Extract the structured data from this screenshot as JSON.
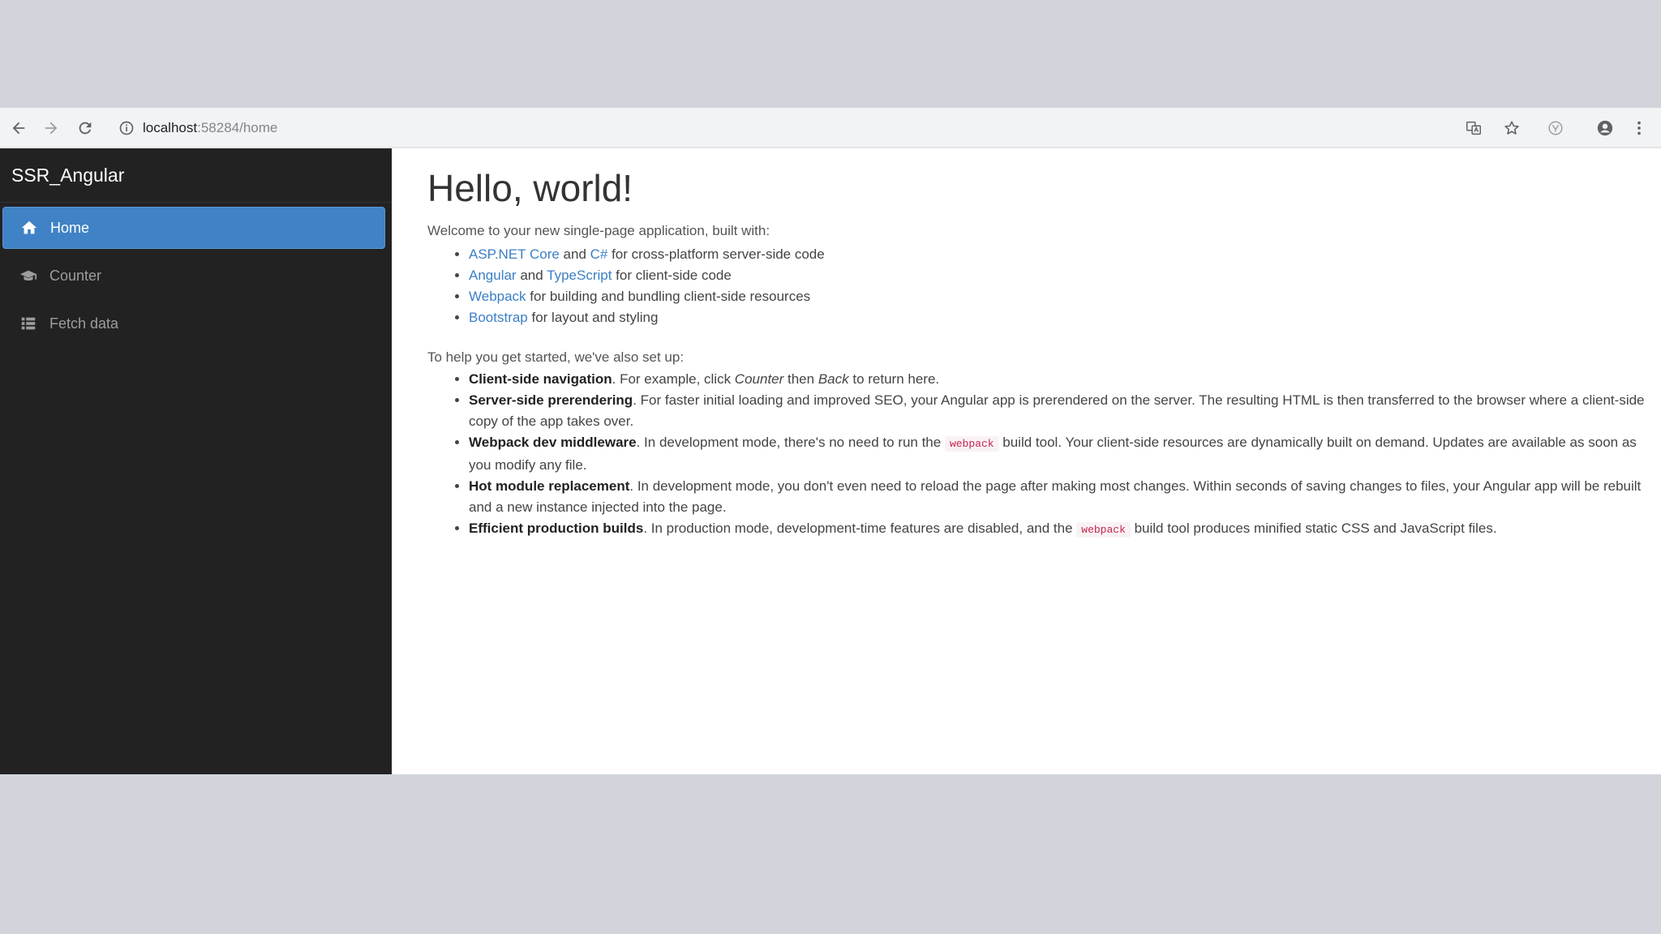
{
  "browser": {
    "url_host": "localhost",
    "url_rest": ":58284/home"
  },
  "sidebar": {
    "brand": "SSR_Angular",
    "items": [
      {
        "label": "Home",
        "icon": "home-icon"
      },
      {
        "label": "Counter",
        "icon": "graduation-cap-icon"
      },
      {
        "label": "Fetch data",
        "icon": "list-icon"
      }
    ]
  },
  "main": {
    "title": "Hello, world!",
    "intro": "Welcome to your new single-page application, built with:",
    "built_with": [
      {
        "link1": "ASP.NET Core",
        "mid": " and ",
        "link2": "C#",
        "rest": " for cross-platform server-side code"
      },
      {
        "link1": "Angular",
        "mid": " and ",
        "link2": "TypeScript",
        "rest": " for client-side code"
      },
      {
        "link1": "Webpack",
        "rest": " for building and bundling client-side resources"
      },
      {
        "link1": "Bootstrap",
        "rest": " for layout and styling"
      }
    ],
    "setup_intro": "To help you get started, we've also set up:",
    "features": [
      {
        "bold": "Client-side navigation",
        "t1": ". For example, click ",
        "em1": "Counter",
        "t2": " then ",
        "em2": "Back",
        "t3": " to return here."
      },
      {
        "bold": "Server-side prerendering",
        "text": ". For faster initial loading and improved SEO, your Angular app is prerendered on the server. The resulting HTML is then transferred to the browser where a client-side copy of the app takes over."
      },
      {
        "bold": "Webpack dev middleware",
        "t1": ". In development mode, there's no need to run the ",
        "code": "webpack",
        "t2": " build tool. Your client-side resources are dynamically built on demand. Updates are available as soon as you modify any file."
      },
      {
        "bold": "Hot module replacement",
        "text": ". In development mode, you don't even need to reload the page after making most changes. Within seconds of saving changes to files, your Angular app will be rebuilt and a new instance injected into the page."
      },
      {
        "bold": "Efficient production builds",
        "t1": ". In production mode, development-time features are disabled, and the ",
        "code": "webpack",
        "t2": " build tool produces minified static CSS and JavaScript files."
      }
    ]
  }
}
